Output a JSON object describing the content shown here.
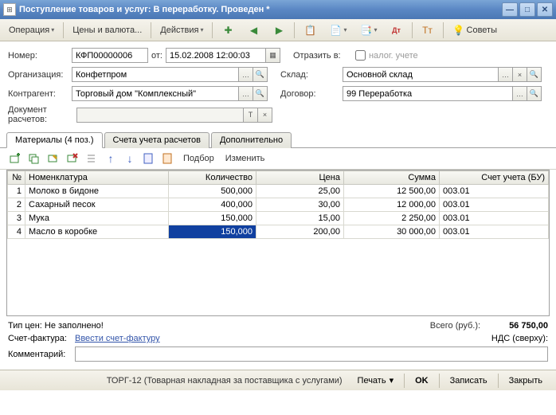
{
  "window": {
    "title": "Поступление товаров и услуг: В переработку. Проведен *"
  },
  "toolbar": {
    "operation": "Операция",
    "prices": "Цены и валюта...",
    "actions": "Действия",
    "tips": "Советы"
  },
  "form": {
    "number_label": "Номер:",
    "number": "КФП00000006",
    "from_label": "от:",
    "date": "15.02.2008 12:00:03",
    "reflect_label": "Отразить в:",
    "reflect_opt": "налог. учете",
    "org_label": "Организация:",
    "org": "Конфетпром",
    "warehouse_label": "Склад:",
    "warehouse": "Основной склад",
    "counterparty_label": "Контрагент:",
    "counterparty": "Торговый дом \"Комплексный\"",
    "contract_label": "Договор:",
    "contract": "99 Переработка",
    "doc_calc_label": "Документ расчетов:"
  },
  "tabs": {
    "materials": "Материалы (4 поз.)",
    "accounts": "Счета учета расчетов",
    "extra": "Дополнительно"
  },
  "inner_tb": {
    "select": "Подбор",
    "edit": "Изменить"
  },
  "grid": {
    "cols": {
      "no": "№",
      "nom": "Номенклатура",
      "qty": "Количество",
      "price": "Цена",
      "sum": "Сумма",
      "acct": "Счет учета (БУ)"
    },
    "rows": [
      {
        "no": "1",
        "nom": "Молоко в бидоне",
        "qty": "500,000",
        "price": "25,00",
        "sum": "12 500,00",
        "acct": "003.01"
      },
      {
        "no": "2",
        "nom": "Сахарный песок",
        "qty": "400,000",
        "price": "30,00",
        "sum": "12 000,00",
        "acct": "003.01"
      },
      {
        "no": "3",
        "nom": "Мука",
        "qty": "150,000",
        "price": "15,00",
        "sum": "2 250,00",
        "acct": "003.01"
      },
      {
        "no": "4",
        "nom": "Масло в коробке",
        "qty": "150,000",
        "price": "200,00",
        "sum": "30 000,00",
        "acct": "003.01"
      }
    ]
  },
  "footer": {
    "price_type_label": "Тип цен: Не заполнено!",
    "total_label": "Всего (руб.):",
    "total": "56 750,00",
    "invoice_label": "Счет-фактура:",
    "invoice_link": "Ввести счет-фактуру",
    "vat_label": "НДС (сверху):",
    "comment_label": "Комментарий:"
  },
  "bottom": {
    "doc_form": "ТОРГ-12 (Товарная накладная за поставщика с услугами)",
    "print": "Печать",
    "ok": "OK",
    "save": "Записать",
    "close": "Закрыть"
  }
}
